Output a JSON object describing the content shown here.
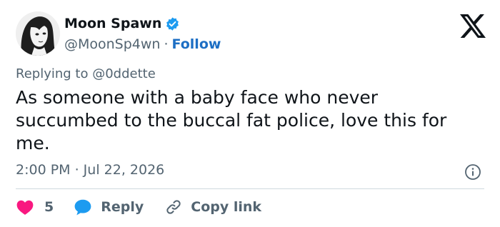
{
  "author": {
    "display_name": "Moon Spawn",
    "handle": "@MoonSp4wn",
    "separator": "·",
    "follow_label": "Follow",
    "verified": true
  },
  "reply_context": {
    "prefix": "Replying to",
    "mention": "@0ddette"
  },
  "tweet": {
    "text": "As someone with a baby face who never succumbed to the buccal fat police, love this for me."
  },
  "meta": {
    "timestamp": "2:00 PM · Jul 22, 2026"
  },
  "actions": {
    "like_count": "5",
    "reply_label": "Reply",
    "copy_label": "Copy link"
  },
  "colors": {
    "accent": "#1d9bf0",
    "follow": "#1d6fc4",
    "like": "#f91880",
    "muted": "#536471",
    "text": "#0f1419"
  },
  "icons": [
    "avatar",
    "verified-badge-icon",
    "x-logo-icon",
    "info-icon",
    "heart-icon",
    "reply-bubble-icon",
    "link-icon"
  ]
}
